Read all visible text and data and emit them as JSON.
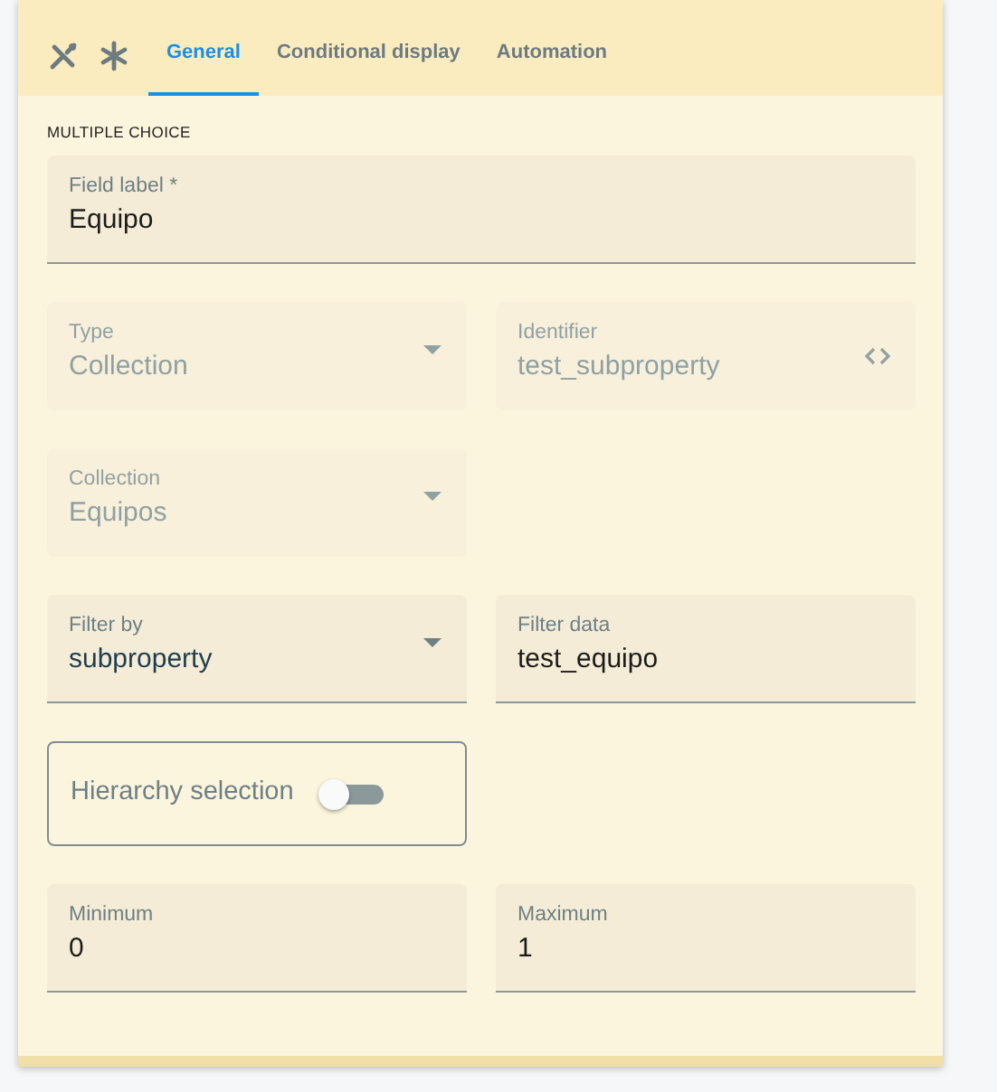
{
  "toolbar_icons": [
    {
      "kind": "tools"
    },
    {
      "kind": "asterisk"
    }
  ],
  "tabs": [
    {
      "label": "General",
      "selected": true
    },
    {
      "label": "Conditional display",
      "selected": false
    },
    {
      "label": "Automation",
      "selected": false
    }
  ],
  "section_title": "MULTIPLE CHOICE",
  "rows": [
    [
      {
        "kind": "text",
        "label": "Field label *",
        "value": "Equipo",
        "disabled": false
      }
    ],
    [
      {
        "kind": "select",
        "label": "Type",
        "value": "Collection",
        "disabled": true
      },
      {
        "kind": "code",
        "label": "Identifier",
        "value": "test_subproperty",
        "disabled": true
      }
    ],
    [
      {
        "kind": "select",
        "label": "Collection",
        "value": "Equipos",
        "disabled": true
      }
    ],
    [
      {
        "kind": "select",
        "label": "Filter by",
        "value": "subproperty",
        "disabled": false
      },
      {
        "kind": "text",
        "label": "Filter data",
        "value": "test_equipo",
        "disabled": false
      }
    ],
    [
      {
        "kind": "toggle",
        "label": "Hierarchy selection",
        "on": false
      }
    ],
    [
      {
        "kind": "text",
        "label": "Minimum",
        "value": "0",
        "disabled": false
      },
      {
        "kind": "text",
        "label": "Maximum",
        "value": "1",
        "disabled": false
      }
    ]
  ]
}
